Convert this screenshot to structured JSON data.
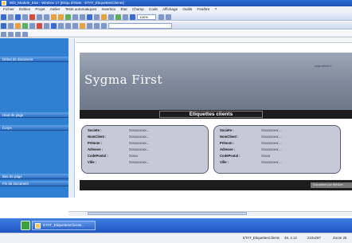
{
  "window": {
    "title": "WD_Modele_Etat - WinDev 17 [Etiqu d'états - ETAT_EtiquettesClients]"
  },
  "menu": {
    "items": [
      "Fichier",
      "Édition",
      "Projet",
      "Atelier",
      "Tests automatiques",
      "Insertion",
      "État",
      "Champ",
      "Code",
      "Affichage",
      "Outils",
      "Fenêtre",
      "?"
    ]
  },
  "toolbar": {
    "zoom_value": "100%"
  },
  "left_panel": {
    "sections": [
      {
        "label": "Début de document"
      },
      {
        "label": "Haut de page"
      },
      {
        "label": "Corps"
      },
      {
        "label": "Bas de page"
      },
      {
        "label": "Fin de document"
      }
    ]
  },
  "report": {
    "brand": "Sygma First",
    "url": "sygmafirst.fr",
    "title": "Etiquettes clients",
    "footer_tag": "Document par WinDev"
  },
  "card": {
    "rows": [
      {
        "label": "Societe :",
        "value": "Xxxxxxxxxx..."
      },
      {
        "label": "NomClient :",
        "value": "Xxxxxxxxxx..."
      },
      {
        "label": "Prénom :",
        "value": "Xxxxxxxxxx..."
      },
      {
        "label": "Adresse :",
        "value": "Xxxxxxxxxx..."
      },
      {
        "label": "CodePostal :",
        "value": "Xxxxx"
      },
      {
        "label": "Ville :",
        "value": "Xxxxxxxxxx..."
      }
    ]
  },
  "taskbar": {
    "task_label": "ETAT_EtiquettesClients..."
  },
  "status": {
    "document": "ETAT_EtiquettesClients",
    "coords": "48, 2.12",
    "size": "210x297",
    "zoom": "Zoom 25"
  }
}
